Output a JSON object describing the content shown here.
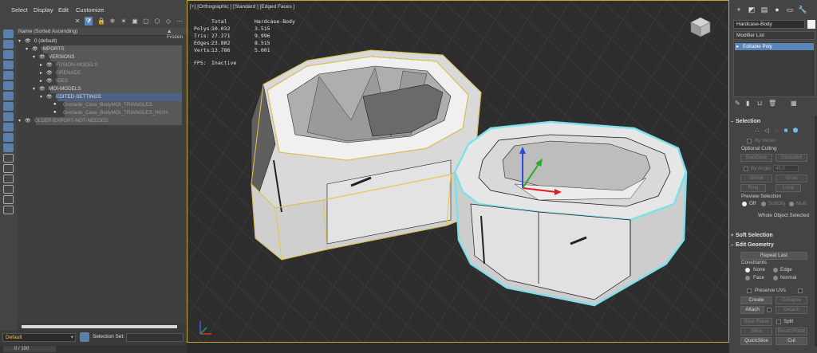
{
  "menu": [
    "Select",
    "Display",
    "Edit",
    "Customize"
  ],
  "explorer": {
    "column_header": "Name (Sorted Ascending)",
    "frozen_header": "▲ Frozen",
    "rows": [
      {
        "label": "0 (default)",
        "depth": 0
      },
      {
        "label": "IMPORTS",
        "depth": 1
      },
      {
        "label": "VERSIONS",
        "depth": 2
      },
      {
        "label": "FUSION-MODELS",
        "depth": 3
      },
      {
        "label": "GRENADE",
        "depth": 3
      },
      {
        "label": "IGES",
        "depth": 3
      },
      {
        "label": "MOI-MODELS",
        "depth": 2
      },
      {
        "label": "EDITED-SETTINGS",
        "depth": 3
      },
      {
        "label": "Grenade_Case_BodyMOI_TRIANGLES",
        "depth": 4
      },
      {
        "label": "Grenade_Case_BodyMOI_TRIANGLES_HIGH",
        "depth": 4
      },
      {
        "label": "OLDER-EXPORT-NOT-NEEDED",
        "depth": 0
      }
    ]
  },
  "bottom": {
    "layer": "Default",
    "selection_set_label": "Selection Set:",
    "frame": "0 / 100"
  },
  "viewport": {
    "label": "[+] [Orthographic ] [Standard ] [Edged Faces ]",
    "stats": {
      "col_total": "Total",
      "col_object": "Hardcase-Body",
      "rows": [
        {
          "name": "Polys:",
          "total": "10.032",
          "obj": "3.515"
        },
        {
          "name": "Tris:",
          "total": "27.271",
          "obj": "9.996"
        },
        {
          "name": "Edges:",
          "total": "23.802",
          "obj": "8.515"
        },
        {
          "name": "Verts:",
          "total": "13.786",
          "obj": "5.001"
        }
      ],
      "fps_label": "FPS:",
      "fps_value": "Inactive"
    }
  },
  "command_panel": {
    "object_name": "Hardcase-Body",
    "modifier_list": "Modifier List",
    "stack_item": "Editable Poly",
    "selection": {
      "title": "Selection",
      "by_vertex": "By Vertex",
      "optional_culling": "Optional Culling",
      "backface": "Backface",
      "occluded": "Occluded",
      "by_angle": "By Angle:",
      "angle_value": "45,0",
      "shrink": "Shrink",
      "grow": "Grow",
      "ring": "Ring",
      "loop": "Loop",
      "preview_selection": "Preview Selection",
      "off": "Off",
      "subobj": "SubObj",
      "multi": "Multi",
      "whole_object": "Whole Object Selected"
    },
    "soft_selection": "Soft Selection",
    "edit_geometry": {
      "title": "Edit Geometry",
      "repeat_last": "Repeat Last",
      "constraints": "Constraints",
      "none": "None",
      "edge": "Edge",
      "face": "Face",
      "normal": "Normal",
      "preserve_uvs": "Preserve UVs",
      "create": "Create",
      "collapse": "Collapse",
      "attach": "Attach",
      "detach": "Detach",
      "slice_plane": "Slice Plane",
      "split": "Split",
      "slice": "Slice",
      "reset_plane": "Reset Plane",
      "quickslice": "QuickSlice",
      "cut": "Cut"
    }
  },
  "colors": {
    "accent": "#5b86b9",
    "viewport_border": "#c7a92e",
    "selected_wire": "#e5c64a",
    "selected_outline": "#7fe0ea"
  }
}
